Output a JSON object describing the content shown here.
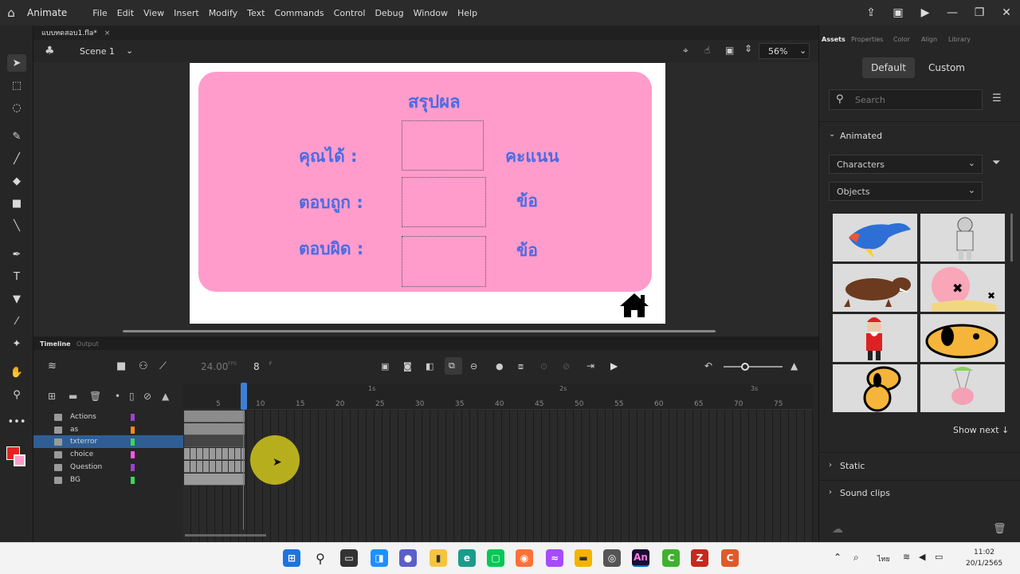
{
  "app": {
    "name": "Animate"
  },
  "menu": [
    "File",
    "Edit",
    "View",
    "Insert",
    "Modify",
    "Text",
    "Commands",
    "Control",
    "Debug",
    "Window",
    "Help"
  ],
  "document": {
    "tab_title": "แบบทดสอบ1.fla*",
    "close": "×"
  },
  "scene": {
    "label": "Scene 1",
    "zoom": "56%"
  },
  "stage": {
    "title": "สรุปผล",
    "row1_label": "คุณได้ :",
    "row1_unit": "คะแนน",
    "row2_label": "ตอบถูก :",
    "row2_unit": "ข้อ",
    "row3_label": "ตอบผิด :",
    "row3_unit": "ข้อ"
  },
  "timeline": {
    "tab_timeline": "Timeline",
    "tab_output": "Output",
    "fps": "24.00",
    "fps_unit": "FPS",
    "frame": "8",
    "frame_unit": "F",
    "seconds": [
      "1s",
      "2s",
      "3s"
    ],
    "frame_numbers": [
      "5",
      "10",
      "15",
      "20",
      "25",
      "30",
      "35",
      "40",
      "45",
      "50",
      "55",
      "60",
      "65",
      "70",
      "75"
    ],
    "layers": [
      {
        "name": "Actions",
        "color": "#a040d0"
      },
      {
        "name": "as",
        "color": "#ff8a1a"
      },
      {
        "name": "txterror",
        "color": "#33dd55"
      },
      {
        "name": "choice",
        "color": "#ff55ee"
      },
      {
        "name": "Question",
        "color": "#a040d0"
      },
      {
        "name": "BG",
        "color": "#33dd55"
      }
    ],
    "selected_layer": "txterror"
  },
  "right_panel": {
    "tabs": [
      "Assets",
      "Properties",
      "Color",
      "Align",
      "Library"
    ],
    "default_btn": "Default",
    "custom_btn": "Custom",
    "search_placeholder": "Search",
    "animated": "Animated",
    "characters": "Characters",
    "objects": "Objects",
    "show_next": "Show next ↓",
    "static": "Static",
    "sound_clips": "Sound clips"
  },
  "taskbar": {
    "time": "11:02",
    "date": "20/1/2565",
    "lang": "ไทย"
  },
  "colors": {
    "stage_pink": "#ff9ccb",
    "thai_text": "#4d6be0",
    "selected_layer": "#2f5e95"
  }
}
